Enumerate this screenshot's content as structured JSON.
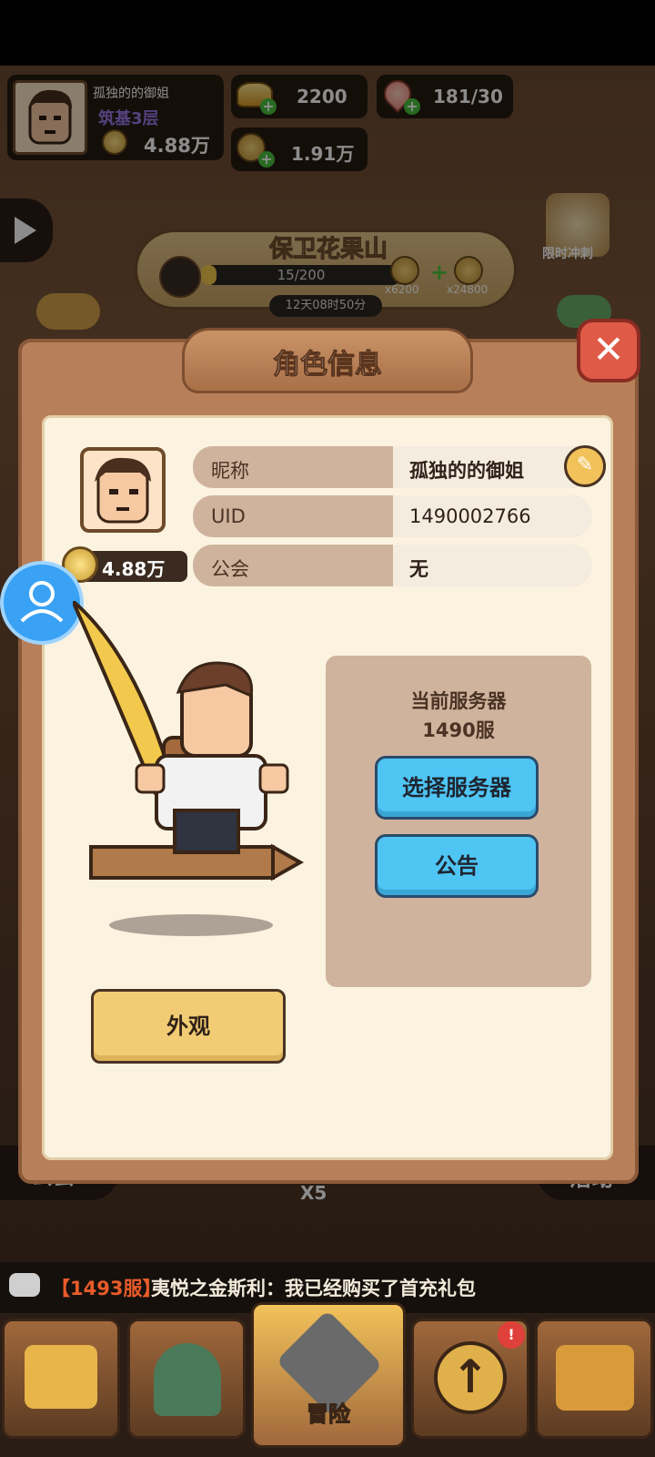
{
  "player": {
    "name": "孤独的的御姐",
    "realm": "筑基3层",
    "power": "4.88万"
  },
  "resources": {
    "gold": "2200",
    "peach": "181/30",
    "coins": "1.91万"
  },
  "event": {
    "title": "保卫花果山",
    "progress_text": "15/200",
    "progress": 0.075,
    "reward1": "x6200",
    "reward2": "x24800",
    "countdown": "12天08时50分",
    "limited_label": "限时冲刺"
  },
  "panel": {
    "title": "角色信息",
    "rows": [
      {
        "label": "昵称",
        "value": "孤独的的御姐"
      },
      {
        "label": "UID",
        "value": "1490002766"
      },
      {
        "label": "公会",
        "value": "无"
      }
    ],
    "power": "4.88万",
    "server_label": "当前服务器",
    "server_value": "1490服",
    "select_server": "选择服务器",
    "notice": "公告",
    "appearance": "外观"
  },
  "bg_labels": {
    "guild": "公会",
    "activity": "活动",
    "peach_count": "X5"
  },
  "chat": {
    "server": "【1493服】",
    "message": "夷悦之金斯利：我已经购买了首充礼包"
  },
  "nav": {
    "adventure": "冒险"
  },
  "colors": {
    "accent_blue": "#4fc5f4",
    "panel_brown": "#b8805a",
    "cream": "#fbf3e0"
  }
}
